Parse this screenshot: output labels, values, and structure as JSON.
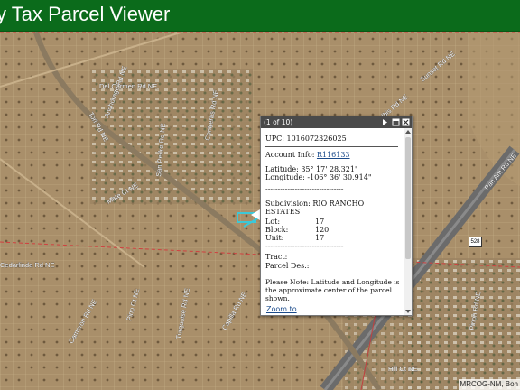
{
  "header": {
    "title": "y Tax Parcel Viewer"
  },
  "popup": {
    "count": "(1 of 10)",
    "upc_label": "UPC:",
    "upc_value": "1016072326025",
    "account_label": "Account Info:",
    "account_value": "R116133",
    "latitude": "Latitude: 35° 17' 28.321\"",
    "longitude": "Longitude: -106° 36' 30.914\"",
    "divider": "--------------------------------",
    "subdivision_label": "Subdivision:",
    "subdivision_value": "RIO RANCHO",
    "subdivision_value2": "ESTATES",
    "lot_label": "Lot:",
    "lot_value": "17",
    "block_label": "Block:",
    "block_value": "120",
    "unit_label": "Unit:",
    "unit_value": "17",
    "divider2": "--------------------------------",
    "tract_label": "Tract:",
    "parcel_des_label": "Parcel Des.:",
    "note_line1": "Please Note: Latitude and Longitude is",
    "note_line2": "the approximate center of the parcel",
    "note_line3": "shown.",
    "zoom_to": "Zoom to"
  },
  "map": {
    "attribution": "MRCOG-NM, Boh",
    "highway_shield": "528",
    "road_labels": [
      "Anchorage Rd NE",
      "Del Carmen Rd NE",
      "Tori Rd NE",
      "Contreras Rd NE",
      "San Pedro Rd NE",
      "Mate Ct NE",
      "Cannon Rd NE",
      "Cedarlinda Rd NE",
      "Cameron Rd NE",
      "Santa Fe Rd NE",
      "Pan Am Rd NE",
      "Pino Ct NE",
      "Turquoise Rd NE",
      "Sunset Rd NE",
      "Pin Ct Rd NE",
      "Hill Ct NE",
      "Capilla Rd NE",
      "Pinon Rd NE",
      "Ibis Rd NE"
    ],
    "icon": "map-imagery"
  }
}
